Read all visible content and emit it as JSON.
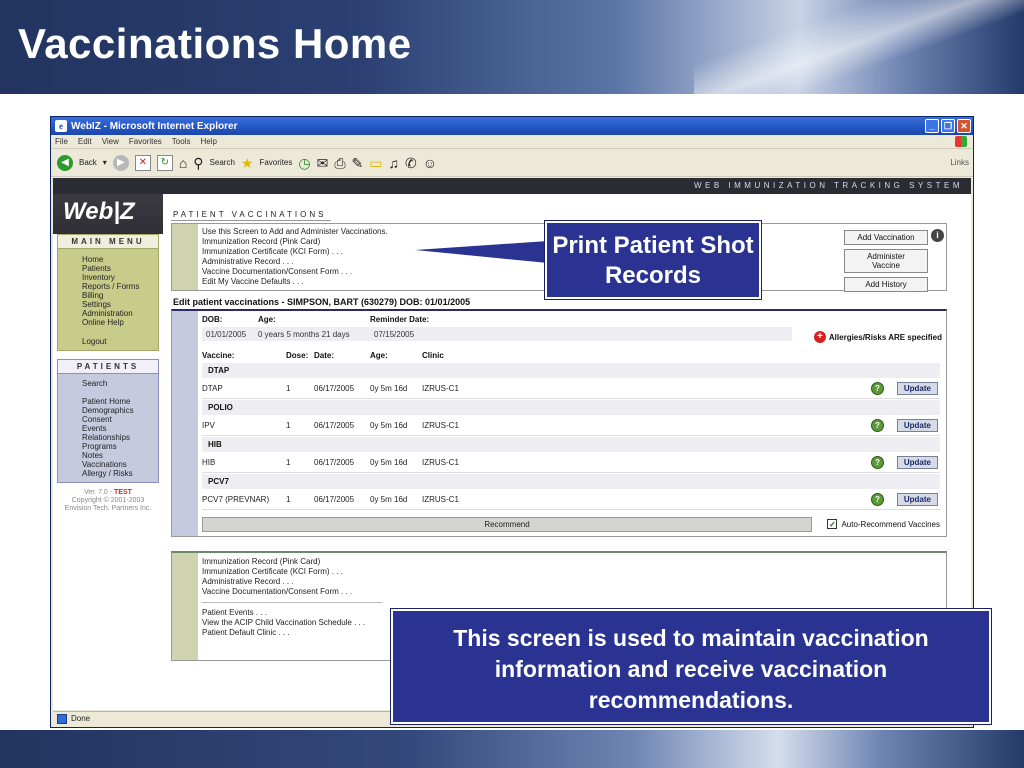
{
  "slide": {
    "title": "Vaccinations Home"
  },
  "browser": {
    "window_title": "WebIZ - Microsoft Internet Explorer",
    "menu": [
      "File",
      "Edit",
      "View",
      "Favorites",
      "Tools",
      "Help"
    ],
    "toolbar": {
      "back": "Back",
      "search": "Search",
      "favorites": "Favorites",
      "links": "Links"
    },
    "status": "Done"
  },
  "app": {
    "tagline": "WEB IMMUNIZATION TRACKING SYSTEM",
    "logo": "Web|Z",
    "main_menu": {
      "title": "MAIN MENU",
      "items": [
        "Home",
        "Patients",
        "Inventory",
        "Reports / Forms",
        "Billing",
        "Settings",
        "Administration",
        "Online Help"
      ],
      "logout": "Logout"
    },
    "patients_menu": {
      "title": "PATIENTS",
      "search": "Search",
      "items": [
        "Patient Home",
        "Demographics",
        "Consent",
        "Events",
        "Relationships",
        "Programs",
        "Notes",
        "Vaccinations",
        "Allergy / Risks"
      ]
    },
    "version": {
      "prefix": "Ver. 7.0 -",
      "env": "TEST",
      "copyright": "Copyright © 2001-2003",
      "company": "Envision Tech. Partners Inc."
    }
  },
  "patient_vaccinations": {
    "section_title": "PATIENT VACCINATIONS",
    "links": [
      "Use this Screen to Add and Administer Vaccinations.",
      "Immunization Record (Pink Card)",
      "Immunization Certificate (KCI Form) . . .",
      "Administrative Record . . .",
      "Vaccine Documentation/Consent Form . . .",
      "Edit My Vaccine Defaults . . ."
    ],
    "buttons": {
      "add_vaccination": "Add Vaccination",
      "administer_vaccine": "Administer Vaccine",
      "add_history": "Add History"
    },
    "info_icon": "i"
  },
  "edit": {
    "title": "Edit patient vaccinations - SIMPSON, BART (630279) DOB: 01/01/2005",
    "labels": {
      "dob": "DOB:",
      "age": "Age:",
      "reminder": "Reminder Date:"
    },
    "values": {
      "dob": "01/01/2005",
      "age": "0 years 5 months 21 days",
      "reminder": "07/15/2005"
    },
    "allergy_text": "Allergies/Risks ARE specified",
    "columns": {
      "vaccine": "Vaccine:",
      "dose": "Dose:",
      "date": "Date:",
      "age": "Age:",
      "clinic": "Clinic"
    },
    "groups": [
      {
        "group": "DTAP",
        "vaccine": "DTAP",
        "dose": "1",
        "date": "06/17/2005",
        "age": "0y 5m 16d",
        "clinic": "IZRUS-C1"
      },
      {
        "group": "POLIO",
        "vaccine": "IPV",
        "dose": "1",
        "date": "06/17/2005",
        "age": "0y 5m 16d",
        "clinic": "IZRUS-C1"
      },
      {
        "group": "HIB",
        "vaccine": "HIB",
        "dose": "1",
        "date": "06/17/2005",
        "age": "0y 5m 16d",
        "clinic": "IZRUS-C1"
      },
      {
        "group": "PCV7",
        "vaccine": "PCV7 (PREVNAR)",
        "dose": "1",
        "date": "06/17/2005",
        "age": "0y 5m 16d",
        "clinic": "IZRUS-C1"
      }
    ],
    "update_label": "Update",
    "help_glyph": "?",
    "recommend": "Recommend",
    "auto_recommend": "Auto-Recommend Vaccines",
    "auto_recommend_checked": true
  },
  "bottom_links": {
    "group1": [
      "Immunization Record (Pink Card)",
      "Immunization Certificate (KCI Form) . . .",
      "Administrative Record . . .",
      "Vaccine Documentation/Consent Form . . ."
    ],
    "group2": [
      "Patient Events . . .",
      "View the ACIP Child Vaccination Schedule . . .",
      "Patient Default Clinic . . ."
    ]
  },
  "callouts": {
    "print": "Print Patient Shot Records",
    "description": "This screen is used to maintain vaccination information and receive vaccination recommendations."
  }
}
